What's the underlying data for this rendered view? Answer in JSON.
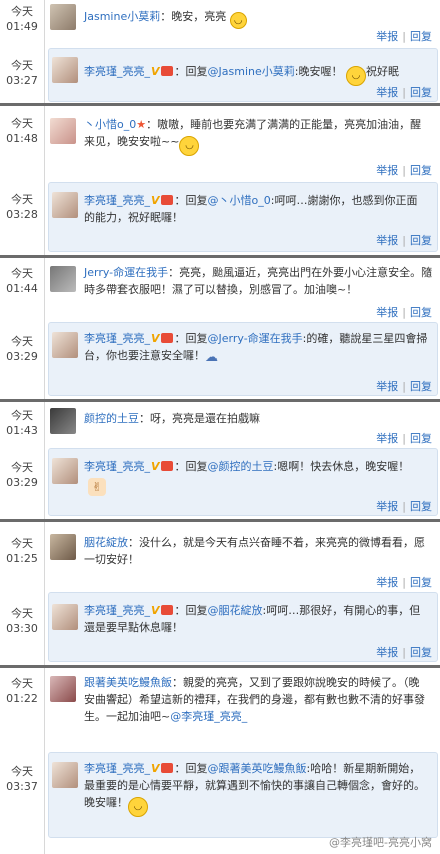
{
  "actions": {
    "report": "举报",
    "reply": "回复",
    "separator": "|"
  },
  "blocks": [
    {
      "comment": {
        "time_day": "今天",
        "time_clock": "01:49",
        "name": "Jasmine小莫莉",
        "text": "：晚安，亮亮",
        "emoji": "smile-face-icon"
      },
      "reply": {
        "time_day": "今天",
        "time_clock": "03:27",
        "name": "李亮瑾_亮亮_",
        "prefix": "：回复",
        "mention": "@Jasmine小莫莉",
        "text_line1": ":晚安喔！",
        "text_line1_end": "祝好眠"
      }
    },
    {
      "comment": {
        "time_day": "今天",
        "time_clock": "01:48",
        "name": "丶小惜o_0",
        "text_line1": "：嗷嗷，睡前也要充满了满满的正能量，亮亮加油油，醒",
        "text_line2": "来见，晚安安啦~~"
      },
      "reply": {
        "time_day": "今天",
        "time_clock": "03:28",
        "name": "李亮瑾_亮亮_",
        "prefix": "：回复",
        "mention": "@丶小惜o_0",
        "text_line1": ":呵呵…謝謝你，也感到你正面",
        "text_line2": "的能力，祝好眠囉！"
      }
    },
    {
      "comment": {
        "time_day": "今天",
        "time_clock": "01:44",
        "name": "Jerry-命運在我手",
        "text_line1": "：亮亮，颱風逼近，亮亮出門在外要小心注意安全。隨",
        "text_line2": "時多帶套衣服吧！濕了可以替換，別感冒了。加油噢~！"
      },
      "reply": {
        "time_day": "今天",
        "time_clock": "03:29",
        "name": "李亮瑾_亮亮_",
        "prefix": "：回复",
        "mention": "@Jerry-命運在我手",
        "text_line1": ":的確，聽說星三星四會掃",
        "text_line2": "台，你也要注意安全囉！"
      }
    },
    {
      "comment": {
        "time_day": "今天",
        "time_clock": "01:43",
        "name": "颜控的土豆",
        "text": "：呀，亮亮是還在拍戲嘛"
      },
      "reply": {
        "time_day": "今天",
        "time_clock": "03:29",
        "name": "李亮瑾_亮亮_",
        "prefix": "：回复",
        "mention": "@颜控的土豆",
        "text_line1": ":嗯啊！快去休息，晚安喔！"
      }
    },
    {
      "comment": {
        "time_day": "今天",
        "time_clock": "01:25",
        "name": "胭花綻放",
        "text_line1": "：没什么，就是今天有点兴奋睡不着，来亮亮的微博看看，愿",
        "text_line2": "一切安好！"
      },
      "reply": {
        "time_day": "今天",
        "time_clock": "03:30",
        "name": "李亮瑾_亮亮_",
        "prefix": "：回复",
        "mention": "@胭花綻放",
        "text_line1": ":呵呵…那很好，有開心的事，但",
        "text_line2": "還是要早點休息囉！"
      }
    },
    {
      "comment": {
        "time_day": "今天",
        "time_clock": "01:22",
        "name": "跟著美英吃鰻魚飯",
        "text_line1": "：親愛的亮亮，又到了要跟妳說晚安的時候了。（晚",
        "text_line2": "安曲響起）希望這新的禮拜，在我們的身邊，都有數也數不清的好事發",
        "text_line3": "生。一起加油吧~",
        "mention": "@李亮瑾_亮亮_"
      },
      "reply": {
        "time_day": "今天",
        "time_clock": "03:37",
        "name": "李亮瑾_亮亮_",
        "prefix": "：回复",
        "mention": "@跟著美英吃鰻魚飯",
        "text_line1": ":哈哈！新星期新開始，",
        "text_line2": "最重要的是心情要平靜，就算遇到不愉快的事讓自己轉個念，會好的。",
        "text_line3": "晚安囉！"
      }
    }
  ],
  "watermark": "@李亮瑾吧-亮亮小窝"
}
